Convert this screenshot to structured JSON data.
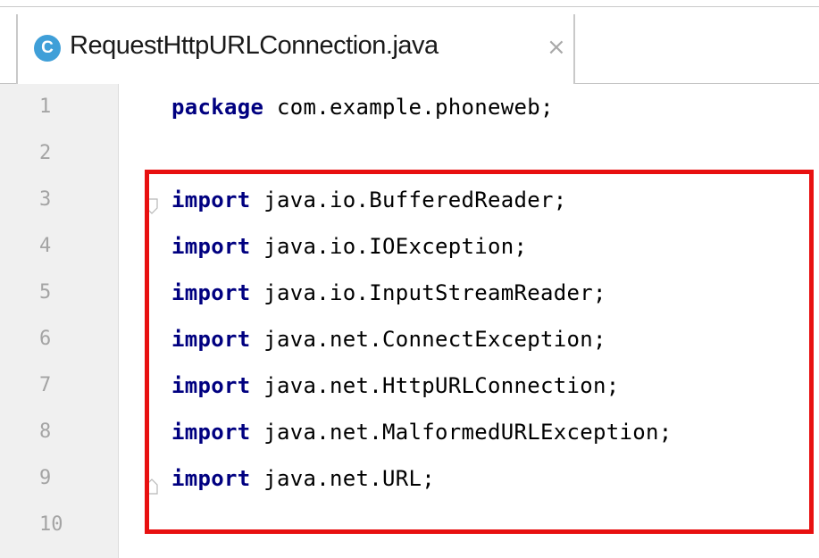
{
  "tab": {
    "icon_letter": "C",
    "filename": "RequestHttpURLConnection.java",
    "close_glyph": "×"
  },
  "editor": {
    "lines": [
      {
        "number": "1",
        "keyword": "package",
        "rest": " com.example.phoneweb;"
      },
      {
        "number": "2",
        "keyword": "",
        "rest": ""
      },
      {
        "number": "3",
        "keyword": "import",
        "rest": " java.io.BufferedReader;"
      },
      {
        "number": "4",
        "keyword": "import",
        "rest": " java.io.IOException;"
      },
      {
        "number": "5",
        "keyword": "import",
        "rest": " java.io.InputStreamReader;"
      },
      {
        "number": "6",
        "keyword": "import",
        "rest": " java.net.ConnectException;"
      },
      {
        "number": "7",
        "keyword": "import",
        "rest": " java.net.HttpURLConnection;"
      },
      {
        "number": "8",
        "keyword": "import",
        "rest": " java.net.MalformedURLException;"
      },
      {
        "number": "9",
        "keyword": "import",
        "rest": " java.net.URL;"
      },
      {
        "number": "10",
        "keyword": "",
        "rest": ""
      }
    ]
  },
  "colors": {
    "keyword": "#000080",
    "highlight_border": "#e81010",
    "class_icon": "#3f9fd8"
  },
  "icons": {
    "tab_icon": "java-class-icon",
    "close": "close-icon",
    "fold_start": "fold-start-icon",
    "fold_end": "fold-end-icon"
  }
}
